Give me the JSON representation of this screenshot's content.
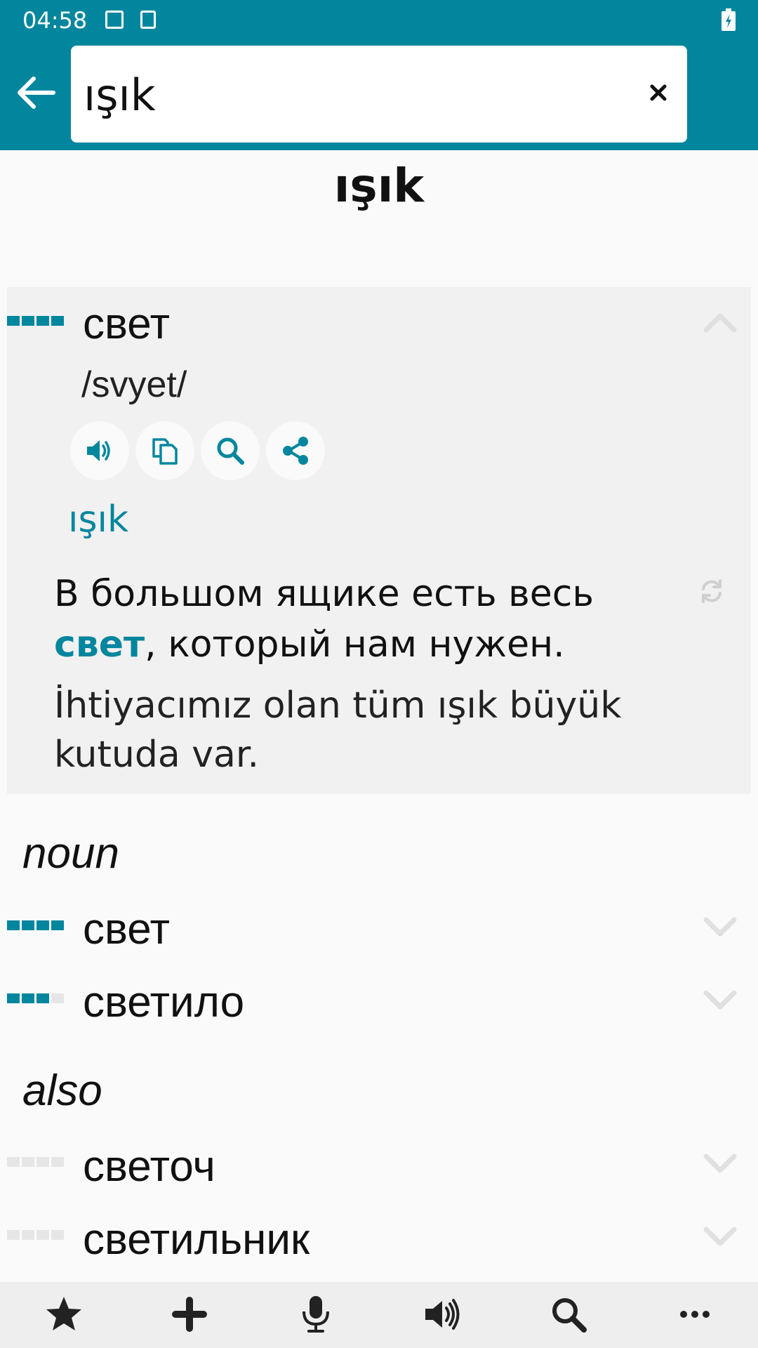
{
  "status": {
    "time": "04:58"
  },
  "search": {
    "query": "ışık"
  },
  "headword": "ışık",
  "primary": {
    "word": "свет",
    "transliteration": "/svyet/",
    "lemma": "ışık",
    "example_ru_before": "В большом ящике есть весь ",
    "example_ru_highlight": "свет",
    "example_ru_after": ", который нам нужен.",
    "example_tr": "İhtiyacımız olan tüm ışık büyük kutuda var."
  },
  "sections": {
    "noun_label": "noun",
    "noun_items": [
      "свет",
      "светило"
    ],
    "also_label": "also",
    "also_items": [
      "светоч",
      "светильник"
    ]
  },
  "colors": {
    "accent": "#01869e",
    "appbar": "#01869e",
    "card": "#f1f1f1",
    "bottom_bar": "#eeeeee"
  },
  "icons": {
    "appbar": [
      "back-arrow-icon",
      "clear-icon"
    ],
    "actions": [
      "speaker-icon",
      "copy-icon",
      "search-icon",
      "share-icon"
    ],
    "bottom_bar": [
      "star-icon",
      "plus-icon",
      "microphone-icon",
      "speaker-icon",
      "search-icon",
      "more-icon"
    ]
  },
  "frequency": {
    "primary": 4,
    "noun": [
      4,
      3
    ],
    "also": [
      0,
      0
    ]
  }
}
